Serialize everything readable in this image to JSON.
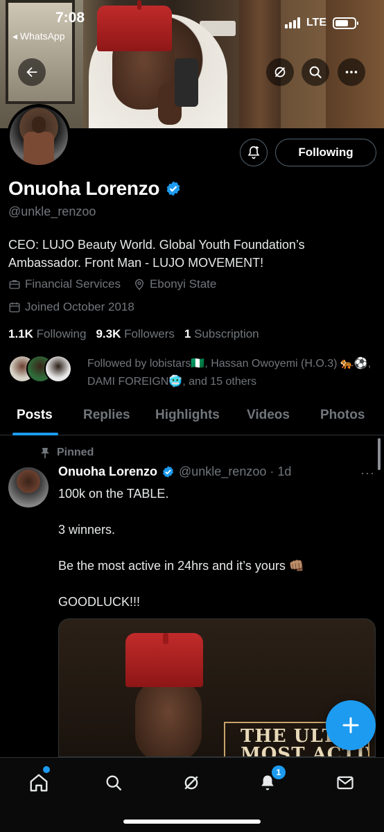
{
  "status_bar": {
    "time": "7:08",
    "back_app": "◂ WhatsApp",
    "network": "LTE"
  },
  "profile": {
    "name": "Onuoha Lorenzo",
    "handle": "@unkle_renzoo",
    "bio": "CEO: LUJO Beauty World. Global Youth Foundation’s Ambassador. Front Man - LUJO MOVEMENT!",
    "category": "Financial Services",
    "location": "Ebonyi State",
    "joined": "Joined October 2018",
    "following_count": "1.1K",
    "following_label": "Following",
    "followers_count": "9.3K",
    "followers_label": "Followers",
    "subscription_count": "1",
    "subscription_label": "Subscription",
    "followed_by": "Followed by lobistars🇳🇬, Hassan Owoyemi (H.O.3) 🐅⚽, DAMI FOREIGN🥶, and 15 others",
    "following_button": "Following",
    "verified_color": "#1d9bf0"
  },
  "tabs": [
    "Posts",
    "Replies",
    "Highlights",
    "Videos",
    "Photos"
  ],
  "active_tab": "Posts",
  "post": {
    "pinned_label": "Pinned",
    "author": "Onuoha Lorenzo",
    "handle_time": "@unkle_renzoo · 1d",
    "lines": [
      "100k on the TABLE.",
      "3 winners.",
      "Be the most active in 24hrs and it’s yours 👊🏽",
      "GOODLUCK!!!"
    ],
    "media_text_line1": "THE ULTIMA",
    "media_text_line2": "MOST ACTIVE"
  },
  "bottom_nav": {
    "items": [
      "home-icon",
      "search-icon",
      "grok-icon",
      "notifications-icon",
      "messages-icon"
    ],
    "notification_count": "1"
  },
  "colors": {
    "accent": "#1d9bf0",
    "background": "#000000",
    "muted": "#71767b"
  }
}
